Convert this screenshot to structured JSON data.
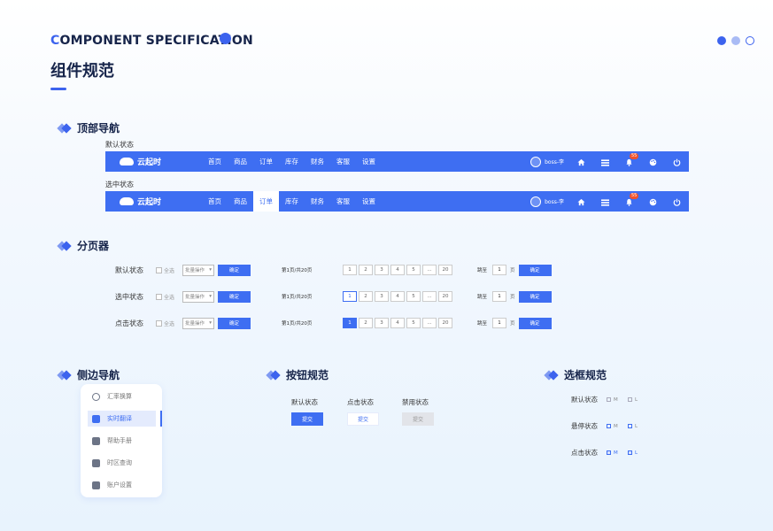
{
  "header": {
    "title_en_first": "C",
    "title_en_rest": "OMPONENT SPECIFICATION",
    "title_cn": "组件规范"
  },
  "sections": {
    "top_nav": "顶部导航",
    "pagination": "分页器",
    "side_nav": "侧边导航",
    "buttons": "按钮规范",
    "checkbox": "选框规范"
  },
  "top_nav": {
    "default_label": "默认状态",
    "selected_label": "选中状态",
    "logo": "云起时",
    "menu": [
      "首页",
      "商品",
      "订单",
      "库存",
      "财务",
      "客服",
      "设置"
    ],
    "active_index": 2,
    "user": "boss-李",
    "badge": "55"
  },
  "pagination": {
    "rows": [
      {
        "label": "默认状态",
        "state": "default"
      },
      {
        "label": "选中状态",
        "state": "selected"
      },
      {
        "label": "点击状态",
        "state": "clicked"
      }
    ],
    "select_all": "全选",
    "batch": "批量操作",
    "confirm": "确定",
    "info": "第1页/共20页",
    "pages": [
      "1",
      "2",
      "3",
      "4",
      "5",
      "...",
      "20"
    ],
    "goto": "跳至",
    "goto_value": "1",
    "page_unit": "页"
  },
  "side_nav": {
    "items": [
      "汇率换算",
      "实时翻译",
      "帮助手册",
      "时区查询",
      "账户设置"
    ],
    "active_index": 1
  },
  "buttons": {
    "default_label": "默认状态",
    "clicked_label": "点击状态",
    "disabled_label": "禁用状态",
    "submit": "提交"
  },
  "checkbox": {
    "rows": [
      {
        "label": "默认状态",
        "state": "default"
      },
      {
        "label": "悬停状态",
        "state": "hover"
      },
      {
        "label": "点击状态",
        "state": "checked"
      }
    ],
    "option_m": "M",
    "option_l": "L"
  },
  "colors": {
    "primary": "#3e6ef2",
    "accent_badge": "#f0532d",
    "title": "#16244a"
  }
}
